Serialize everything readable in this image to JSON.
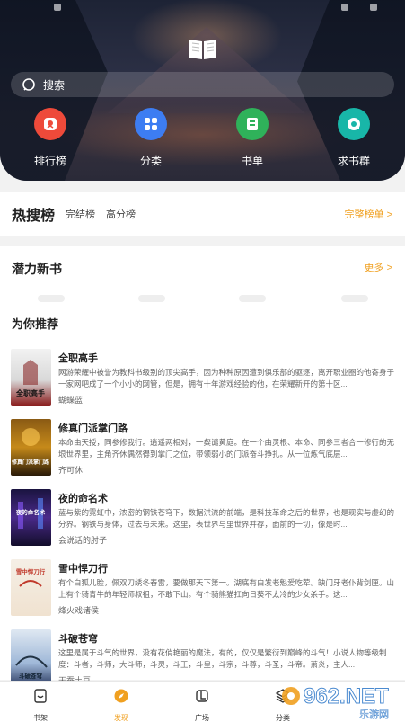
{
  "search": {
    "placeholder": "搜索"
  },
  "categories": [
    {
      "label": "排行榜",
      "icon": "ranking-icon",
      "color": "#ee4a3a"
    },
    {
      "label": "分类",
      "icon": "category-icon",
      "color": "#3d7df2"
    },
    {
      "label": "书单",
      "icon": "booklist-icon",
      "color": "#2fb25a"
    },
    {
      "label": "求书群",
      "icon": "request-group-icon",
      "color": "#18b6a8"
    }
  ],
  "hot": {
    "title": "热搜榜",
    "tabs": [
      "完结榜",
      "高分榜"
    ],
    "more": "完整榜单 >"
  },
  "potential": {
    "title": "潜力新书",
    "more": "更多 >"
  },
  "recommend": {
    "title": "为你推荐",
    "books": [
      {
        "title": "全职高手",
        "desc": "网游荣耀中被誉为教科书级别的顶尖高手，因为种种原因遭到俱乐部的驱逐，离开职业圈的他寄身于一家网吧成了一个小小的网管，但是，拥有十年游戏经验的他，在荣耀新开的第十区...",
        "author": "蝴蝶蓝",
        "cover_text": "全职高手"
      },
      {
        "title": "修真门派掌门路",
        "desc": "本命由天授，同参修我行。逍遥两相对，一粲谴黄庭。在一个由灵根、本命、同参三者合一修行的无垠世界里，主角齐休偶然得到掌门之位，带领弱小的门派奋斗挣扎。从一位炼气底层...",
        "author": "齐可休",
        "cover_text": "修真门派掌门路"
      },
      {
        "title": "夜的命名术",
        "desc": "蓝与紫的霓虹中，浓密的钢铁苍穹下，数据洪流的前端，是科技革命之后的世界，也是现实与虚幻的分界。钢铁与身体，过去与未来。这里，表世界与里世界并存，面前的一切，像是时...",
        "author": "会说话的肘子",
        "cover_text": "夜的命名术"
      },
      {
        "title": "雪中悍刀行",
        "desc": "有个白狐儿脸，佩双刀绣冬春雷，要做那天下第一。湖底有白发老魁爱吃荤。缺门牙老仆背剑匣。山上有个骑青牛的年轻师叔祖，不敢下山。有个骑熊猫扛向日葵不太冷的少女杀手。这...",
        "author": "烽火戏诸侯",
        "cover_text": "雪中悍刀行"
      },
      {
        "title": "斗破苍穹",
        "desc": "这里是属于斗气的世界，没有花俏艳丽的魔法，有的，仅仅是繁衍到巅峰的斗气！小说人物等级制度：斗者，斗师，大斗师，斗灵，斗王，斗皇，斗宗，斗尊，斗圣，斗帝。萧炎，主人...",
        "author": "天蚕土豆",
        "cover_text": "斗破苍穹"
      }
    ]
  },
  "bottom_nav": [
    {
      "label": "书架",
      "icon": "bookshelf-icon",
      "active": false
    },
    {
      "label": "发现",
      "icon": "discover-icon",
      "active": true
    },
    {
      "label": "广场",
      "icon": "plaza-icon",
      "active": false
    },
    {
      "label": "分类",
      "icon": "category-nav-icon",
      "active": false
    }
  ],
  "watermark": {
    "brand": "962.NET",
    "sub": "乐游网"
  },
  "colors": {
    "accent": "#f0a020",
    "hero_bg": "#24283a"
  }
}
